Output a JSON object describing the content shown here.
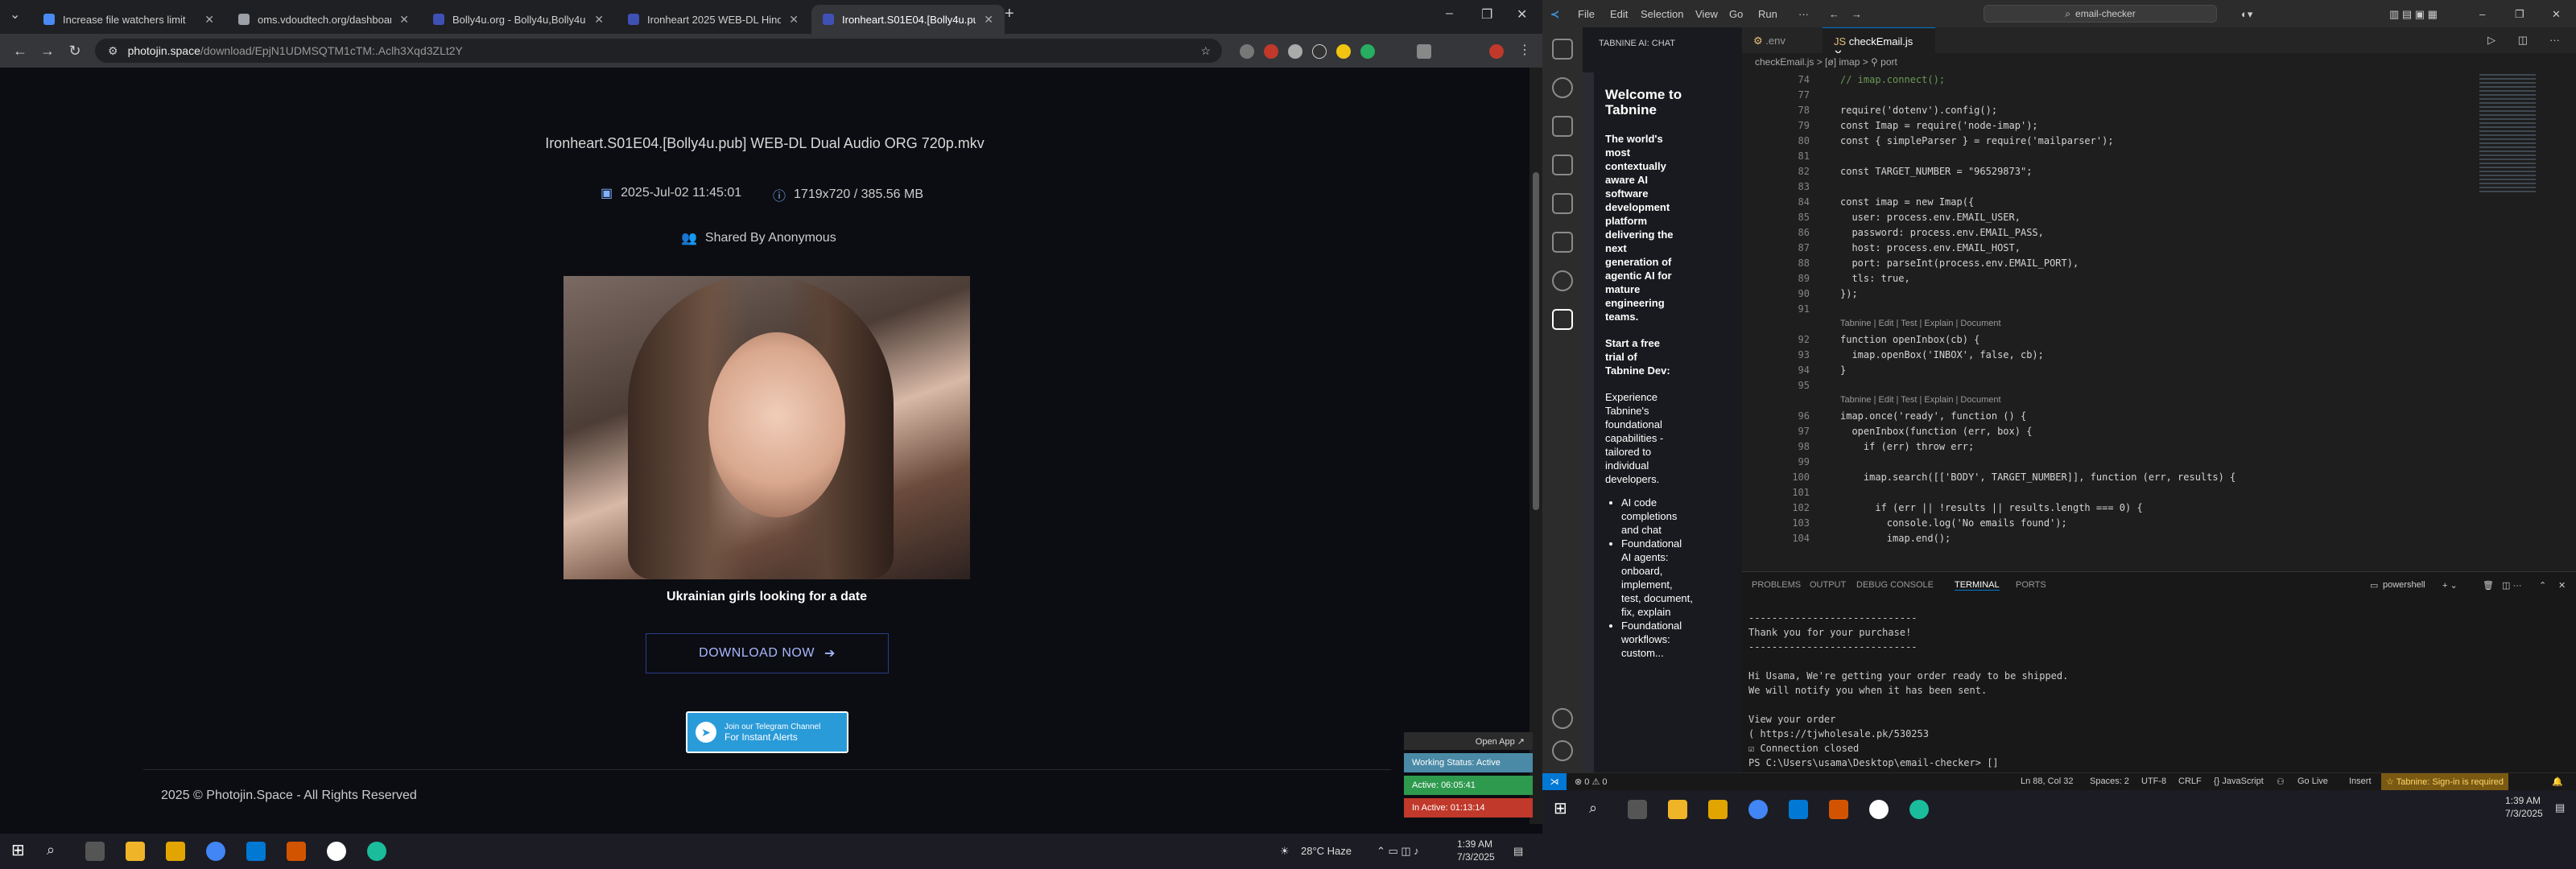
{
  "browser": {
    "tabs": [
      {
        "title": "Increase file watchers limit",
        "color": "#4a8af4"
      },
      {
        "title": "oms.vdoudtech.org/dashboard",
        "color": "#9aa0a6"
      },
      {
        "title": "Bolly4u.org - Bolly4u,Bolly4u.b",
        "color": "#3f51b5"
      },
      {
        "title": "Ironheart 2025 WEB-DL Hindi D",
        "color": "#3f51b5"
      },
      {
        "title": "Ironheart.S01E04.[Bolly4u.pub]",
        "color": "#3f51b5"
      }
    ],
    "url_host": "photojin.space",
    "url_path": "/download/EpjN1UDMSQTM1cTM:.Aclh3Xqd3ZLt2Y"
  },
  "page": {
    "filename": "Ironheart.S01E04.[Bolly4u.pub] WEB-DL Dual Audio ORG 720p.mkv",
    "date": "2025-Jul-02 11:45:01",
    "info": "1719x720 / 385.56 MB",
    "shared": "Shared By Anonymous",
    "ad_caption": "Ukrainian girls looking for a date",
    "download_label": "DOWNLOAD NOW",
    "telegram_line1": "Join our Telegram Channel",
    "telegram_line2": "For Instant Alerts",
    "copyright": "2025 © Photojin.Space - All Rights Reserved"
  },
  "widget": {
    "open_app": "Open App ↗",
    "status": "Working Status: Active",
    "active": "Active: 06:05:41",
    "inactive": "In Active: 01:13:14"
  },
  "taskbar_left": {
    "weather": "28°C  Haze",
    "time": "1:39 AM",
    "date": "7/3/2025"
  },
  "vscode": {
    "menu": [
      "File",
      "Edit",
      "Selection",
      "View",
      "Go",
      "Run"
    ],
    "command_center": "email-checker",
    "sidebar_title": "TABNINE AI: CHAT",
    "welcome_title": "Welcome to Tabnine",
    "welcome_intro": "The world's most contextually aware AI software development platform delivering the next generation of agentic AI for mature engineering teams.",
    "trial_title": "Start a free trial of Tabnine Dev:",
    "trial_body": "Experience Tabnine's foundational capabilities - tailored to individual developers.",
    "bullets": [
      "AI code completions and chat",
      "Foundational AI agents: onboard, implement, test, document, fix, explain",
      "Foundational workflows: custom..."
    ],
    "tabs": [
      ".env",
      "checkEmail.js"
    ],
    "breadcrumb": "checkEmail.js > [ø] imap > ⚲ port",
    "code_lines": [
      {
        "n": "74",
        "t": "// imap.connect();"
      },
      {
        "n": "77",
        "t": ""
      },
      {
        "n": "78",
        "t": "require('dotenv').config();"
      },
      {
        "n": "79",
        "t": "const Imap = require('node-imap');"
      },
      {
        "n": "80",
        "t": "const { simpleParser } = require('mailparser');"
      },
      {
        "n": "81",
        "t": ""
      },
      {
        "n": "82",
        "t": "const TARGET_NUMBER = \"96529873\";"
      },
      {
        "n": "83",
        "t": ""
      },
      {
        "n": "84",
        "t": "const imap = new Imap({"
      },
      {
        "n": "85",
        "t": "  user: process.env.EMAIL_USER,"
      },
      {
        "n": "86",
        "t": "  password: process.env.EMAIL_PASS,"
      },
      {
        "n": "87",
        "t": "  host: process.env.EMAIL_HOST,"
      },
      {
        "n": "88",
        "t": "  port: parseInt(process.env.EMAIL_PORT),"
      },
      {
        "n": "89",
        "t": "  tls: true,"
      },
      {
        "n": "90",
        "t": "});"
      },
      {
        "n": "91",
        "t": ""
      },
      {
        "n": "92",
        "t": "function openInbox(cb) {"
      },
      {
        "n": "93",
        "t": "  imap.openBox('INBOX', false, cb);"
      },
      {
        "n": "94",
        "t": "}"
      },
      {
        "n": "95",
        "t": ""
      },
      {
        "n": "96",
        "t": "imap.once('ready', function () {"
      },
      {
        "n": "97",
        "t": "  openInbox(function (err, box) {"
      },
      {
        "n": "98",
        "t": "    if (err) throw err;"
      },
      {
        "n": "99",
        "t": ""
      },
      {
        "n": "100",
        "t": "    imap.search([['BODY', TARGET_NUMBER]], function (err, results) {"
      },
      {
        "n": "101",
        "t": ""
      },
      {
        "n": "102",
        "t": "      if (err || !results || results.length === 0) {"
      },
      {
        "n": "103",
        "t": "        console.log('No emails found');"
      },
      {
        "n": "104",
        "t": "        imap.end();"
      }
    ],
    "codelens": "Tabnine | Edit | Test | Explain | Document",
    "panel_tabs": [
      "PROBLEMS",
      "OUTPUT",
      "DEBUG CONSOLE",
      "TERMINAL",
      "PORTS"
    ],
    "terminal_name": "powershell",
    "terminal_lines": [
      "-----------------------------",
      "Thank you for your purchase!",
      "-----------------------------",
      "",
      "Hi Usama, We're getting your order ready to be shipped.",
      "We will notify you when it has been sent.",
      "",
      "View your order",
      "( https://tjwholesale.pk/530253",
      "☑ Connection closed",
      "PS C:\\Users\\usama\\Desktop\\email-checker> []"
    ],
    "status_items": [
      "Ln 88, Col 32",
      "Spaces: 2",
      "UTF-8",
      "CRLF",
      "{} JavaScript",
      "Go Live",
      "Insert"
    ],
    "tabnine_status": "☆ Tabnine: Sign-in is required",
    "errors": "⊗ 0 ⚠ 0",
    "time": "1:39 AM",
    "date": "7/3/2025"
  }
}
